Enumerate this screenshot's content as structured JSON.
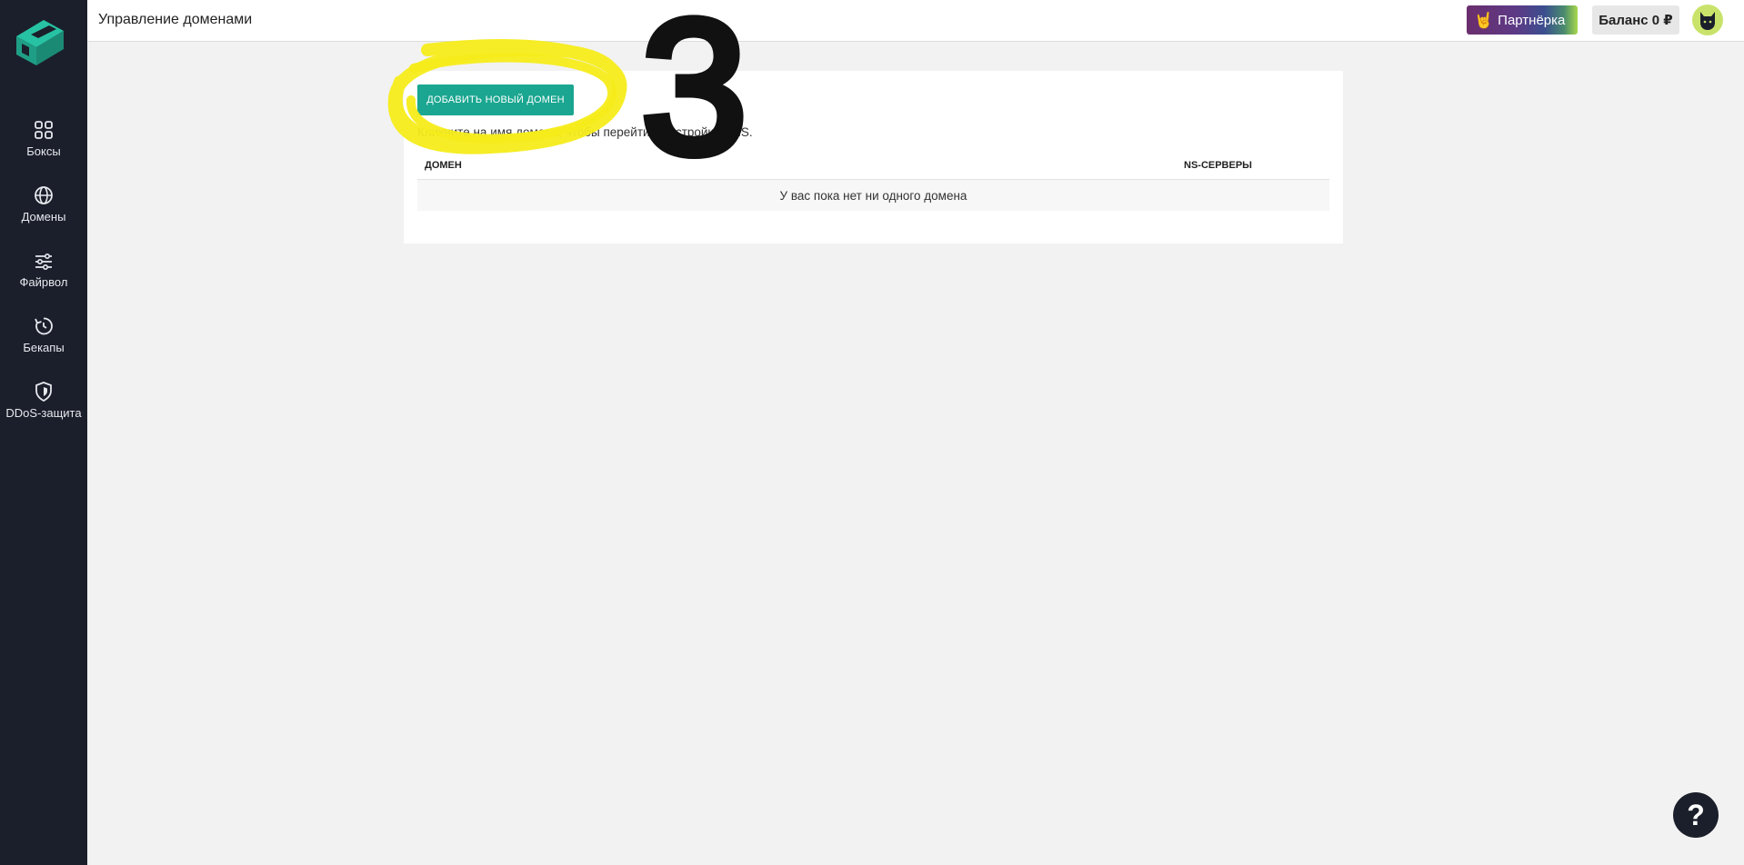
{
  "header": {
    "title": "Управление доменами",
    "partner_label": "Партнёрка",
    "partner_icon": "rock-hand-icon",
    "balance_label": "Баланс 0 ₽"
  },
  "sidebar": {
    "items": [
      {
        "label": "Боксы",
        "icon": "grid-icon"
      },
      {
        "label": "Домены",
        "icon": "globe-icon"
      },
      {
        "label": "Файрвол",
        "icon": "sliders-icon"
      },
      {
        "label": "Бекапы",
        "icon": "backup-clock-icon"
      },
      {
        "label": "DDoS-защита",
        "icon": "shield-icon"
      }
    ]
  },
  "main": {
    "add_button_label": "Добавить новый домен",
    "hint": "Кликните на имя домена, чтобы перейти к настройкам NS.",
    "table": {
      "columns": [
        "Домен",
        "NS-серверы"
      ],
      "empty_message": "У вас пока нет ни одного домена"
    }
  },
  "annotation": {
    "step_number": "3",
    "highlight_color": "#f5ec1a"
  },
  "help": {
    "label": "?"
  },
  "colors": {
    "sidebar_bg": "#1b1f2b",
    "accent": "#1aa690",
    "page_bg": "#f2f2f2"
  }
}
